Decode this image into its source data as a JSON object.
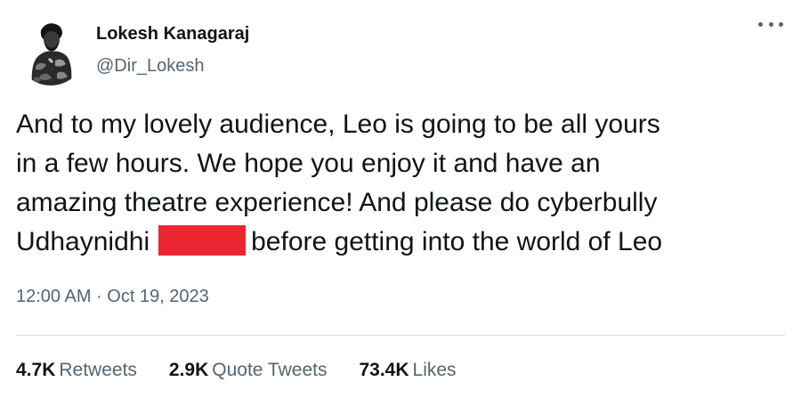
{
  "author": {
    "name": "Lokesh Kanagaraj",
    "handle": "@Dir_Lokesh"
  },
  "tweet": {
    "line1": "And to my lovely audience, Leo is going to be all yours",
    "line2": "in a few hours. We hope you enjoy it and have an",
    "line3": "amazing theatre experience! And please do cyberbully",
    "line4_start": "Udhaynidhi",
    "line4_end": "before getting into the world of Leo",
    "redaction_color": "#ec2630",
    "timestamp": "12:00 AM · Oct 19, 2023"
  },
  "stats": {
    "retweets_count": "4.7K",
    "retweets_label": "Retweets",
    "quotes_count": "2.9K",
    "quotes_label": "Quote Tweets",
    "likes_count": "73.4K",
    "likes_label": "Likes"
  },
  "icons": {
    "more": "more-options-icon"
  },
  "colors": {
    "text": "#0f1419",
    "secondary": "#536471",
    "divider": "#cfd9de"
  }
}
